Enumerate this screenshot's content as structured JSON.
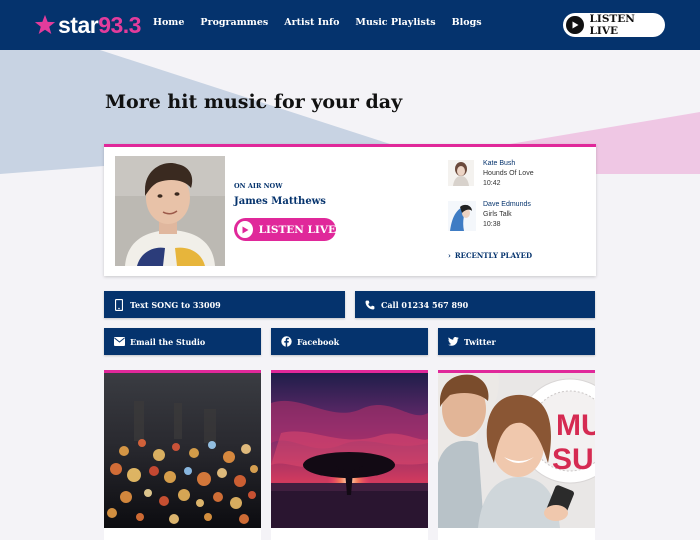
{
  "brand": {
    "name": "star",
    "frequency": "93.3",
    "accent": "#e33c9c",
    "navy": "#05336d"
  },
  "nav": {
    "items": [
      "Home",
      "Programmes",
      "Artist Info",
      "Music Playlists",
      "Blogs"
    ],
    "listen_live": "LISTEN LIVE"
  },
  "hero": {
    "title": "More hit music for your day"
  },
  "on_air": {
    "label": "ON AIR NOW",
    "presenter": "James Matthews",
    "listen_live": "LISTEN LIVE",
    "recently_played": [
      {
        "artist": "Kate Bush",
        "song": "Hounds Of Love",
        "time": "10:42"
      },
      {
        "artist": "Dave Edmunds",
        "song": "Girls Talk",
        "time": "10:38"
      }
    ],
    "recently_played_link": "RECENTLY PLAYED"
  },
  "contact": {
    "text": "Text SONG to 33009",
    "call": "Call 01234 567 890",
    "email": "Email the Studio",
    "facebook": "Facebook",
    "twitter": "Twitter"
  },
  "cards": [
    {
      "image": "city-lights-bokeh"
    },
    {
      "image": "tree-sunset"
    },
    {
      "image": "couple-music-promo",
      "overlay_text": "MUSIC SURVEY"
    }
  ]
}
